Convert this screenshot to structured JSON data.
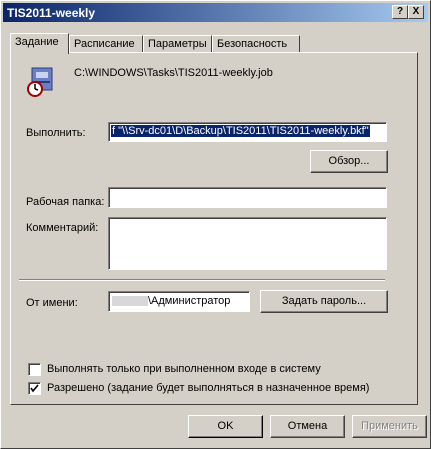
{
  "window": {
    "title": "TIS2011-weekly",
    "help_glyph": "?",
    "close_glyph": "X"
  },
  "tabs": [
    {
      "label": "Задание"
    },
    {
      "label": "Расписание"
    },
    {
      "label": "Параметры"
    },
    {
      "label": "Безопасность"
    }
  ],
  "task": {
    "path": "C:\\WINDOWS\\Tasks\\TIS2011-weekly.job"
  },
  "run": {
    "label": "Выполнить:",
    "value": "f \"\\\\Srv-dc01\\D\\Backup\\TIS2011\\TIS2011-weekly.bkf\""
  },
  "browse_button": "Обзор...",
  "workdir": {
    "label": "Рабочая папка:",
    "value": ""
  },
  "comment": {
    "label": "Комментарий:",
    "value": ""
  },
  "runas": {
    "label": "От имени:",
    "value": "\\Администратор"
  },
  "set_password_button": "Задать пароль...",
  "checkboxes": [
    {
      "label": "Выполнять только при выполненном входе в систему",
      "checked": false
    },
    {
      "label": "Разрешено (задание будет выполняться в назначенное время)",
      "checked": true
    }
  ],
  "buttons": {
    "ok": "OK",
    "cancel": "Отмена",
    "apply": "Применить"
  }
}
